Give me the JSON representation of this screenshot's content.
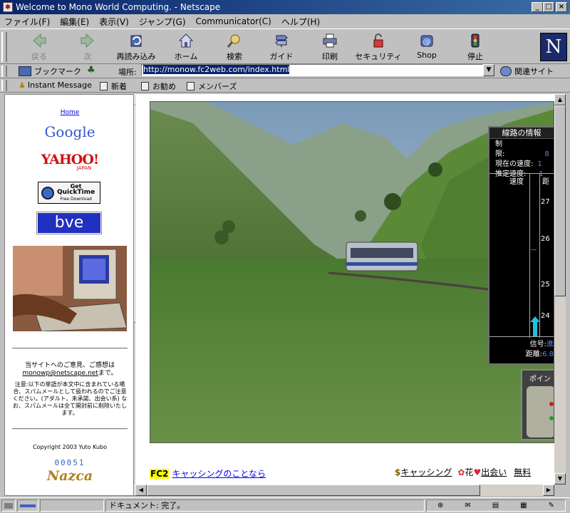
{
  "window": {
    "title": "Welcome to Mono World Computing. - Netscape"
  },
  "menu": [
    "ファイル(F)",
    "編集(E)",
    "表示(V)",
    "ジャンプ(G)",
    "Communicator(C)",
    "ヘルプ(H)"
  ],
  "toolbar": {
    "back": "戻る",
    "forward": "次",
    "reload": "再読み込み",
    "home": "ホーム",
    "search": "検索",
    "guide": "ガイド",
    "print": "印刷",
    "security": "セキュリティ",
    "shop": "Shop",
    "stop": "停止"
  },
  "location": {
    "bookmarks": "ブックマーク",
    "label": "場所:",
    "url": "http://monow.fc2web.com/index.html",
    "related": "関連サイト"
  },
  "personal": {
    "instant": "Instant Message",
    "new": "新着",
    "recommend": "お勧め",
    "members": "メンバーズ"
  },
  "left": {
    "home": "Home",
    "google": "Google",
    "yahoo": "YAHOO!",
    "yahoo_sub": "JAPAN",
    "qt1": "Get",
    "qt2": "QuickTime",
    "qt3": "Free Download",
    "bve": "bve",
    "feedback1": "当サイトへのご意見、ご感想は",
    "feedback_email": "monowp@netscape.net",
    "feedback2": "まで。",
    "notice": "注意:以下の単語が本文中に含まれている場合、スパムメールとして扱われるのでご注意ください。(アダルト、未承諾、出会い系) なお、スパムメールは全て開封前に削除いたします。",
    "copyright": "Copyright 2003 Yuto Kubo",
    "counter": "00051",
    "nazca": "Nazca"
  },
  "panel": {
    "title": "線路の情報",
    "limit_label": "制限:",
    "limit_val": "8",
    "cur_label": "現在の速度:",
    "cur_val": "1",
    "est_label": "推定速度:",
    "est_val": "1",
    "col_speed": "速度",
    "col_dist": "距",
    "t1": "27",
    "t2": "26",
    "t3": "25",
    "t4": "24",
    "signal_label": "信号:",
    "signal_val": "進",
    "dist_label": "距離:",
    "dist_val": "6.8",
    "point": "ポイン"
  },
  "footer": {
    "fc2": "FC2",
    "cashing": "キャッシングのことなら",
    "cashing2": "キャッシング",
    "hana": "花",
    "deai": "出会い",
    "free": "無料"
  },
  "status": {
    "text": "ドキュメント: 完了。"
  }
}
